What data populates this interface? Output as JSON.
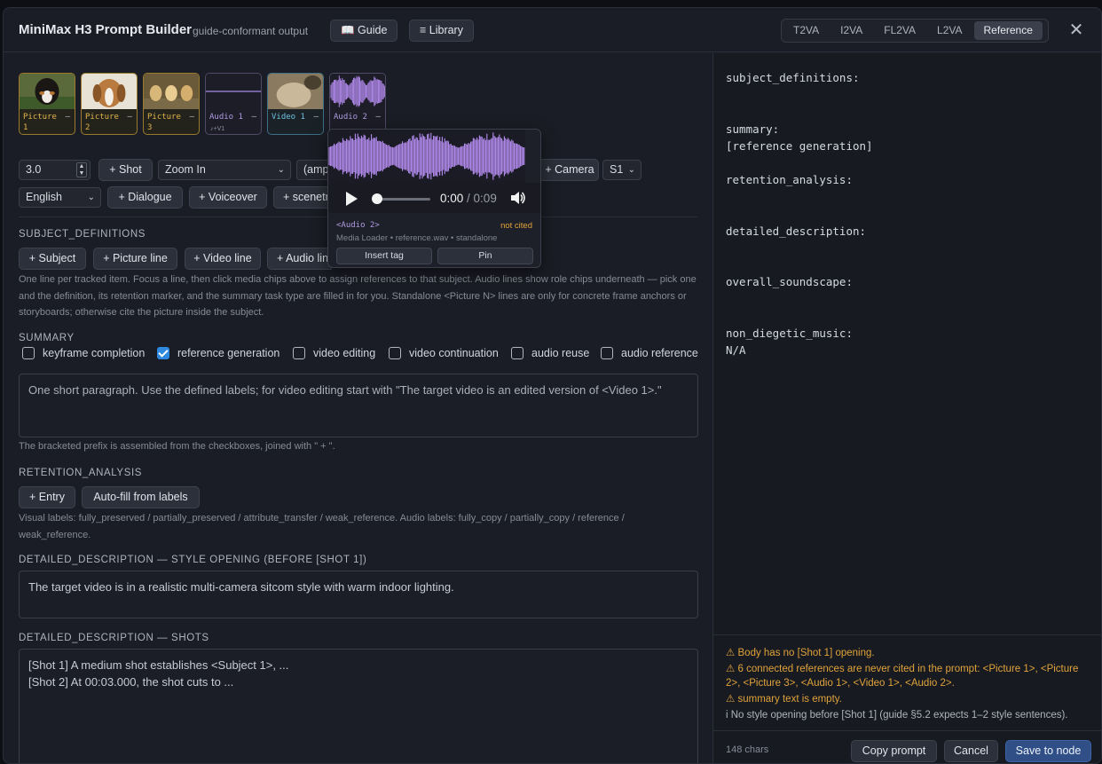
{
  "header": {
    "title": "MiniMax H3 Prompt Builder",
    "subtitle": "guide-conformant output",
    "guide_label": "📖 Guide",
    "library_label": "≡ Library",
    "tabs": [
      "T2VA",
      "I2VA",
      "FL2VA",
      "L2VA",
      "Reference"
    ],
    "active_tab": "Reference",
    "close_icon": "✕"
  },
  "media_chips": [
    {
      "label_line1": "Picture",
      "label_line2": "1",
      "type": "picture"
    },
    {
      "label_line1": "Picture",
      "label_line2": "2",
      "type": "picture"
    },
    {
      "label_line1": "Picture",
      "label_line2": "3",
      "type": "picture"
    },
    {
      "label_line1": "Audio 1",
      "label_line2": "",
      "type": "audio",
      "sub": "♪+V1"
    },
    {
      "label_line1": "Video 1",
      "label_line2": "",
      "type": "video"
    },
    {
      "label_line1": "Audio 2",
      "label_line2": "",
      "type": "audio"
    }
  ],
  "chip_minus": "–",
  "controls": {
    "duration": "3.0",
    "shot_btn": "+ Shot",
    "camera_move": "Zoom In",
    "amp_select": "(ampl",
    "camera_btn": "+ Camera",
    "speaker": "S1",
    "language": "English",
    "dialogue_btn": "+ Dialogue",
    "voiceover_btn": "+ Voiceover",
    "scene_btn": "+ scenetra"
  },
  "subject_definitions": {
    "heading": "SUBJECT_DEFINITIONS",
    "buttons": [
      "+ Subject",
      "+ Picture line",
      "+ Video line",
      "+ Audio line"
    ],
    "help": "One line per tracked item. Focus a line, then click media chips above to assign references to that subject. Audio lines show role chips underneath — pick one and the definition, its retention marker, and the summary task type are filled in for you. Standalone <Picture N> lines are only for concrete frame anchors or storyboards; otherwise cite the picture inside the subject."
  },
  "summary": {
    "heading": "SUMMARY",
    "checkboxes": [
      {
        "label": "keyframe completion",
        "checked": false
      },
      {
        "label": "reference generation",
        "checked": true
      },
      {
        "label": "video editing",
        "checked": false
      },
      {
        "label": "video continuation",
        "checked": false
      },
      {
        "label": "audio reuse",
        "checked": false
      },
      {
        "label": "audio reference",
        "checked": false
      }
    ],
    "placeholder": "One short paragraph. Use the defined labels; for video editing start with \"The target video is an edited version of <Video 1>.\"",
    "help": "The bracketed prefix is assembled from the checkboxes, joined with \" + \"."
  },
  "retention": {
    "heading": "RETENTION_ANALYSIS",
    "entry_btn": "+ Entry",
    "autofill_btn": "Auto-fill from labels",
    "help": "Visual labels: fully_preserved / partially_preserved / attribute_transfer / weak_reference. Audio labels: fully_copy / partially_copy / reference / weak_reference."
  },
  "style_opening": {
    "heading": "DETAILED_DESCRIPTION — STYLE OPENING (BEFORE [SHOT 1])",
    "value": "The target video is in a realistic multi-camera sitcom style with warm indoor lighting."
  },
  "shots": {
    "heading": "DETAILED_DESCRIPTION — SHOTS",
    "lines": [
      "[Shot 1] A medium shot establishes <Subject 1>, ...",
      "[Shot 2] At 00:03.000, the shot cuts to ..."
    ]
  },
  "popover": {
    "time_current": "0:00",
    "time_total": "/ 0:09",
    "tag": "<Audio 2>",
    "status": "not cited",
    "meta": "Media Loader • reference.wav • standalone",
    "insert_btn": "Insert tag",
    "pin_btn": "Pin",
    "wave_color": "#b48cf0"
  },
  "preview": {
    "text": "subject_definitions:\n\n\nsummary:\n[reference generation]\n\nretention_analysis:\n\n\ndetailed_description:\n\n\noverall_soundscape:\n\n\nnon_diegetic_music:\nN/A"
  },
  "warnings": [
    "⚠ Body has no [Shot 1] opening.",
    "⚠ 6 connected references are never cited in the prompt: <Picture 1>, <Picture 2>, <Picture 3>, <Audio 1>, <Video 1>, <Audio 2>.",
    "⚠ summary text is empty."
  ],
  "info": "i No style opening before [Shot 1] (guide §5.2 expects 1–2 style sentences).",
  "footer": {
    "chars": "148 chars",
    "copy_btn": "Copy prompt",
    "cancel_btn": "Cancel",
    "save_btn": "Save to node"
  }
}
